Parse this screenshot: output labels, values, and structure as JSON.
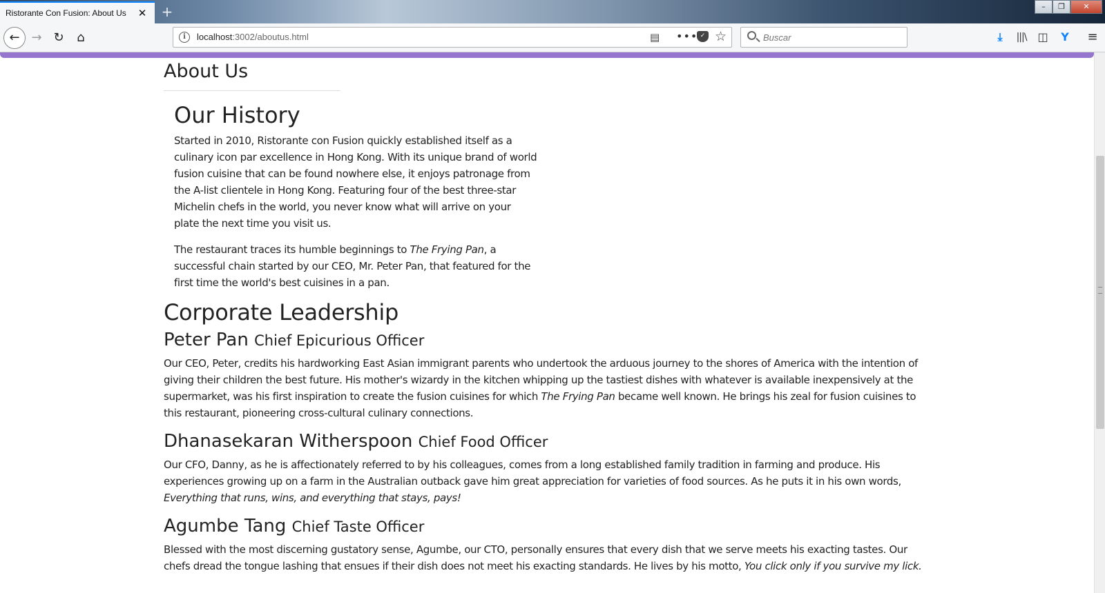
{
  "browser": {
    "tab_title": "Ristorante Con Fusion: About Us",
    "tab_close": "✕",
    "new_tab": "+",
    "url_host": "localhost",
    "url_rest": ":3002/aboutus.html",
    "search_placeholder": "Buscar",
    "window_buttons": {
      "minimize": "–",
      "maximize": "❐",
      "close": "✕"
    },
    "icons": [
      "back-arrow-icon",
      "forward-arrow-icon",
      "reload-icon",
      "home-icon",
      "info-icon",
      "reader-view-icon",
      "more-icon",
      "pocket-icon",
      "bookmark-star-icon",
      "search-icon",
      "download-icon",
      "library-icon",
      "sidebar-icon",
      "extension-icon",
      "hamburger-menu-icon"
    ]
  },
  "page": {
    "title": "About Us",
    "history": {
      "heading": "Our History",
      "p1": "Started in 2010, Ristorante con Fusion quickly established itself as a culinary icon par excellence in Hong Kong. With its unique brand of world fusion cuisine that can be found nowhere else, it enjoys patronage from the A-list clientele in Hong Kong. Featuring four of the best three-star Michelin chefs in the world, you never know what will arrive on your plate the next time you visit us.",
      "p2_before": "The restaurant traces its humble beginnings to ",
      "p2_em": "The Frying Pan",
      "p2_after": ", a successful chain started by our CEO, Mr. Peter Pan, that featured for the first time the world's best cuisines in a pan."
    },
    "leadership": {
      "heading": "Corporate Leadership",
      "leaders": [
        {
          "name": "Peter Pan",
          "role": "Chief Epicurious Officer",
          "bio_before": "Our CEO, Peter, credits his hardworking East Asian immigrant parents who undertook the arduous journey to the shores of America with the intention of giving their children the best future. His mother's wizardy in the kitchen whipping up the tastiest dishes with whatever is available inexpensively at the supermarket, was his first inspiration to create the fusion cuisines for which ",
          "bio_em": "The Frying Pan",
          "bio_after": " became well known. He brings his zeal for fusion cuisines to this restaurant, pioneering cross-cultural culinary connections."
        },
        {
          "name": "Dhanasekaran Witherspoon",
          "role": "Chief Food Officer",
          "bio_before": "Our CFO, Danny, as he is affectionately referred to by his colleagues, comes from a long established family tradition in farming and produce. His experiences growing up on a farm in the Australian outback gave him great appreciation for varieties of food sources. As he puts it in his own words, ",
          "bio_em": "Everything that runs, wins, and everything that stays, pays!",
          "bio_after": ""
        },
        {
          "name": "Agumbe Tang",
          "role": "Chief Taste Officer",
          "bio_before": "Blessed with the most discerning gustatory sense, Agumbe, our CTO, personally ensures that every dish that we serve meets his exacting tastes. Our chefs dread the tongue lashing that ensues if their dish does not meet his exacting standards. He lives by his motto, ",
          "bio_em": "You click only if you survive my lick.",
          "bio_after": ""
        }
      ]
    }
  },
  "colors": {
    "accent": "#9575cd",
    "tab_highlight": "#0a84ff"
  }
}
